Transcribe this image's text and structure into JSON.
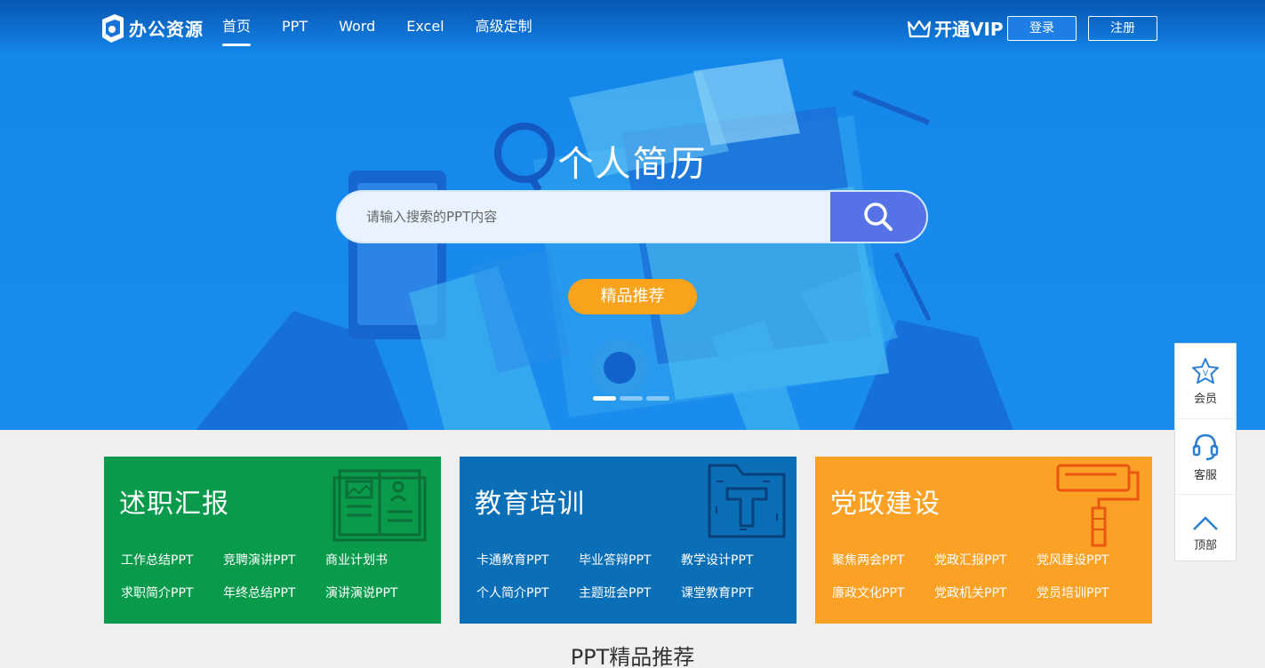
{
  "header": {
    "logo_text": "办公资源",
    "nav": [
      {
        "label": "首页",
        "active": true
      },
      {
        "label": "PPT",
        "active": false
      },
      {
        "label": "Word",
        "active": false
      },
      {
        "label": "Excel",
        "active": false
      },
      {
        "label": "高级定制",
        "active": false
      }
    ],
    "vip_label": "开通VIP",
    "login_label": "登录",
    "register_label": "注册"
  },
  "hero": {
    "title": "个人简历",
    "search_placeholder": "请输入搜索的PPT内容",
    "featured_label": "精品推荐",
    "slides_total": 3,
    "slide_active": 1
  },
  "categories": [
    {
      "title": "述职汇报",
      "color": "#0a9a4c",
      "icon": "report-book-icon",
      "links": [
        "工作总结PPT",
        "竞聘演讲PPT",
        "商业计划书",
        "求职简介PPT",
        "年终总结PPT",
        "演讲演说PPT"
      ]
    },
    {
      "title": "教育培训",
      "color": "#0b6fb8",
      "icon": "education-folder-icon",
      "links": [
        "卡通教育PPT",
        "毕业答辩PPT",
        "教学设计PPT",
        "个人简介PPT",
        "主题班会PPT",
        "课堂教育PPT"
      ]
    },
    {
      "title": "党政建设",
      "color": "#fba125",
      "icon": "paint-roller-icon",
      "links": [
        "聚焦两会PPT",
        "党政汇报PPT",
        "党风建设PPT",
        "廉政文化PPT",
        "党政机关PPT",
        "党员培训PPT"
      ]
    }
  ],
  "section_title": "PPT精品推荐",
  "side_panel": [
    {
      "label": "会员",
      "icon": "vip-star-icon"
    },
    {
      "label": "客服",
      "icon": "headset-icon"
    },
    {
      "label": "顶部",
      "icon": "chevron-up-icon"
    }
  ],
  "colors": {
    "accent": "#1a8cee",
    "search_button": "#5572e6",
    "featured": "#f9a21b"
  }
}
